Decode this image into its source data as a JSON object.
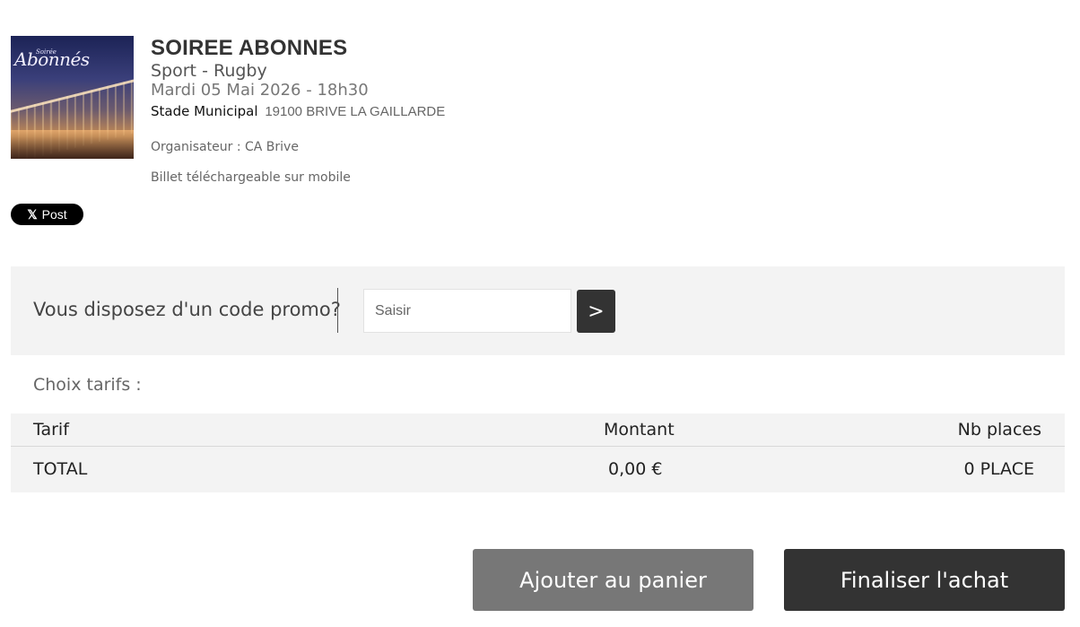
{
  "event": {
    "image_caption_top": "Soirée",
    "image_caption_main": "Abonnés",
    "title": "SOIREE ABONNES",
    "category": "Sport",
    "category_separator": "-",
    "subcategory": "Rugby",
    "datetime": "Mardi 05 Mai 2026 - 18h30",
    "venue_name": "Stade Municipal",
    "venue_address": "19100 BRIVE LA GAILLARDE",
    "organizer": "Organisateur : CA Brive",
    "mobile_note": "Billet téléchargeable sur mobile"
  },
  "share": {
    "icon": "x-icon",
    "label": "Post"
  },
  "promo": {
    "label": "Vous disposez d'un code promo?",
    "input_value": "",
    "input_placeholder": "Saisir",
    "submit_label": ">"
  },
  "tarifs": {
    "heading": "Choix tarifs :",
    "columns": [
      "Tarif",
      "Montant",
      "Nb places"
    ],
    "total_row": {
      "label": "TOTAL",
      "amount": "0,00 €",
      "places": "0 PLACE"
    }
  },
  "actions": {
    "add_to_cart": "Ajouter au panier",
    "checkout": "Finaliser l'achat"
  },
  "colors": {
    "panel_bg": "#f3f3f3",
    "dark_button": "#333333",
    "grey_button": "#777777",
    "x_button": "#000000"
  }
}
